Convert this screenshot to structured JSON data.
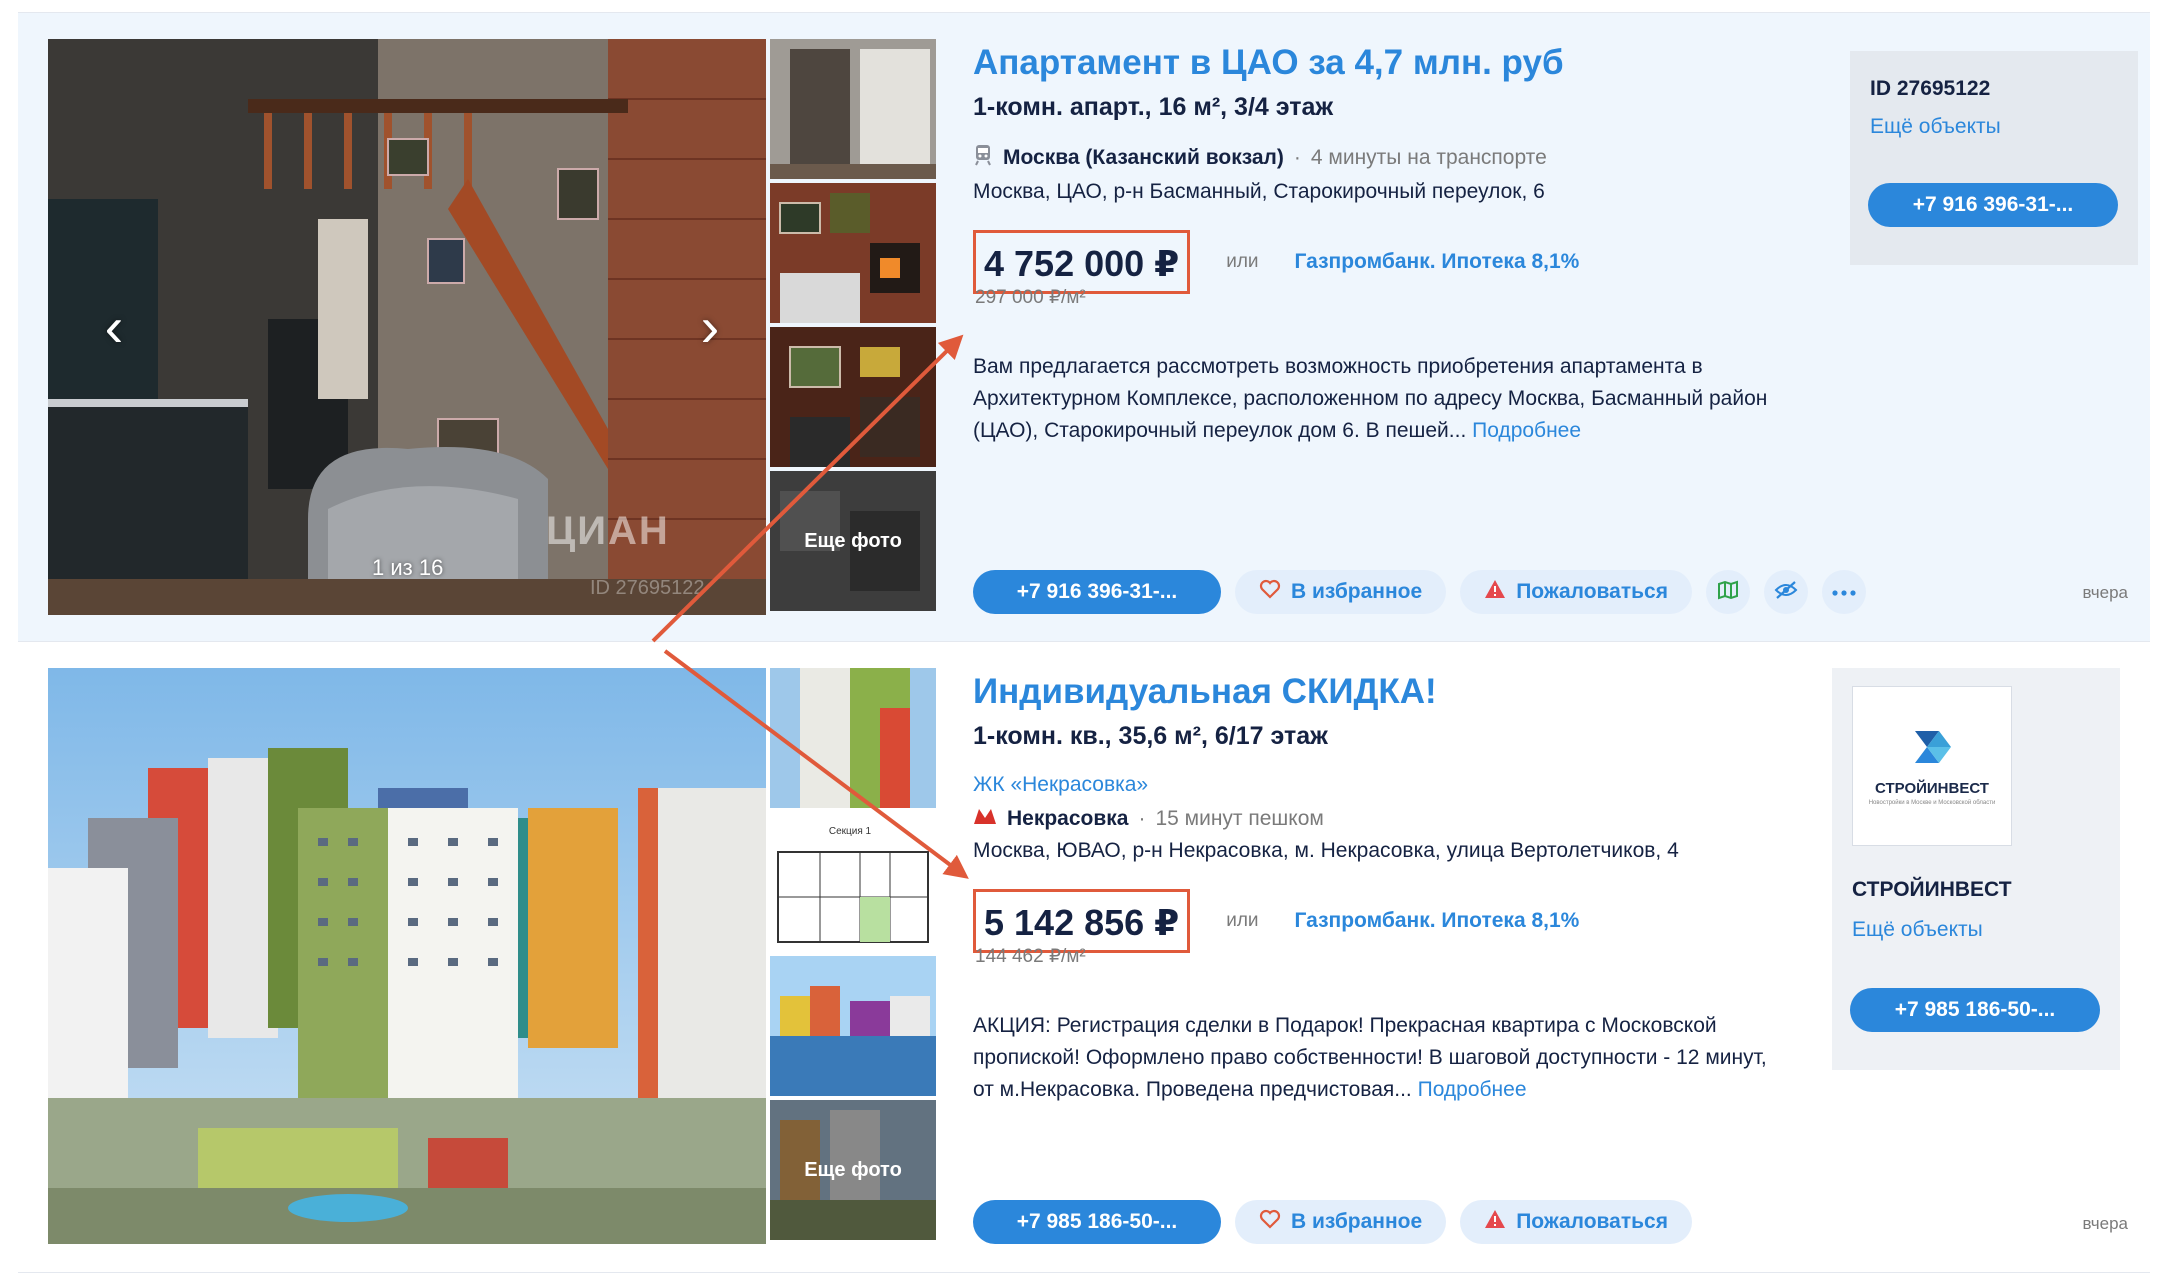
{
  "listings": [
    {
      "title": "Апартамент в ЦАО за 4,7 млн. руб",
      "subtitle": "1-комн. апарт., 16 м², 3/4 этаж",
      "station": "Москва (Казанский вокзал)",
      "station_sep": "·",
      "station_time": "4 минуты на транспорте",
      "address": "Москва, ЦАО, р-н Басманный, Старокирочный переулок, 6",
      "price": "4 752 000 ₽",
      "or": "или",
      "mortgage": "Газпромбанк. Ипотека 8,1%",
      "price_per_m2": "297 000 ₽/м²",
      "description": "Вам предлагается рассмотреть возможность приобретения апартамента в Архитектурном Комплексе, расположенном по адресу Москва, Басманный район (ЦАО), Старокирочный переулок дом 6. В пешей...",
      "more_link": "Подробнее",
      "photo_counter": "1 из 16",
      "more_photos": "Еще фото",
      "watermark": "ЦИАН",
      "watermark_id": "ID 27695122",
      "phone": "+7 916 396-31-...",
      "favorite": "В избранное",
      "complain": "Пожаловаться",
      "date": "вчера",
      "side": {
        "id": "ID 27695122",
        "more": "Ещё объекты",
        "phone": "+7 916 396-31-..."
      }
    },
    {
      "title": "Индивидуальная СКИДКА!",
      "subtitle": "1-комн. кв., 35,6 м², 6/17 этаж",
      "jk": "ЖК «Некрасовка»",
      "station": "Некрасовка",
      "station_sep": "·",
      "station_time": "15 минут пешком",
      "address": "Москва, ЮВАО, р-н Некрасовка, м. Некрасовка, улица Вертолетчиков, 4",
      "price": "5 142 856 ₽",
      "or": "или",
      "mortgage": "Газпромбанк. Ипотека 8,1%",
      "price_per_m2": "144 462 ₽/м²",
      "description": "АКЦИЯ: Регистрация сделки в Подарок! Прекрасная квартира с Московской пропиской! Оформлено право собственности! В шаговой доступности - 12 минут, от м.Некрасовка. Проведена предчистовая...",
      "more_link": "Подробнее",
      "more_photos": "Еще фото",
      "plan_label": "Секция 1",
      "phone": "+7 985 186-50-...",
      "favorite": "В избранное",
      "complain": "Пожаловаться",
      "date": "вчера",
      "side": {
        "logo_text": "СТРОЙИНВЕСТ",
        "logo_tagline": "Новостройки в Москве и Московской области",
        "developer": "СТРОЙИНВЕСТ",
        "more": "Ещё объекты",
        "phone": "+7 985 186-50-..."
      }
    }
  ],
  "colors": {
    "accent": "#2b87db",
    "highlight": "#e05a3b",
    "card1_bg": "#eff6fd",
    "text": "#152242"
  }
}
